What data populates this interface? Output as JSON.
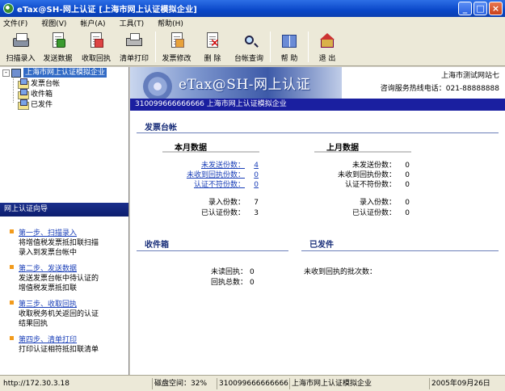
{
  "window": {
    "title": "eTax@SH-网上认证 [上海市网上认证模拟企业]",
    "controls": {
      "minimize": "_",
      "maximize": "□",
      "close": "×"
    }
  },
  "menu": [
    "文件(F)",
    "视图(V)",
    "帐户(A)",
    "工具(T)",
    "帮助(H)"
  ],
  "toolbar": [
    {
      "label": "扫描录入",
      "icon": "scanner-icon"
    },
    {
      "label": "发送数据",
      "icon": "send-data-icon"
    },
    {
      "label": "收取回执",
      "icon": "receive-receipt-icon"
    },
    {
      "label": "清单打印",
      "icon": "print-icon"
    },
    {
      "label": "发票修改",
      "icon": "edit-invoice-icon"
    },
    {
      "label": "删 除",
      "icon": "delete-icon"
    },
    {
      "label": "台帐查询",
      "icon": "query-icon"
    },
    {
      "label": "帮 助",
      "icon": "help-book-icon"
    },
    {
      "label": "退 出",
      "icon": "exit-house-icon"
    }
  ],
  "tree": {
    "toggle": "-",
    "root": "上海市网上认证模拟企业",
    "children": [
      "发票台帐",
      "收件箱",
      "已发件"
    ]
  },
  "guide": {
    "title": "网上认证向导",
    "steps": [
      {
        "title": "第一步、扫描录入",
        "desc1": "将增值税发票抵扣联扫描",
        "desc2": "录入到发票台帐中"
      },
      {
        "title": "第二步、发送数据",
        "desc1": "发送发票台帐中待认证的",
        "desc2": "增值税发票抵扣联"
      },
      {
        "title": "第三步、收取回执",
        "desc1": "收取税务机关返回的认证",
        "desc2": "结果回执"
      },
      {
        "title": "第四步、清单打印",
        "desc1": "打印认证相符抵扣联清单",
        "desc2": ""
      }
    ]
  },
  "banner": {
    "logo": "eTax@SH-网上认证",
    "station": "上海市测试网站七",
    "hotline": "咨询服务热线电话：021-88888888"
  },
  "idbar": "310099666666666  上海市网上认证模拟企业",
  "ledger": {
    "title": "发票台帐",
    "this_month": {
      "title": "本月数据",
      "unsent_label": "未发送份数：",
      "unsent_value": "4",
      "no_receipt_label": "未收到回执份数：",
      "no_receipt_value": "0",
      "mismatch_label": "认证不符份数：",
      "mismatch_value": "0",
      "entered_label": "录入份数：",
      "entered_value": "7",
      "certified_label": "已认证份数：",
      "certified_value": "3"
    },
    "last_month": {
      "title": "上月数据",
      "unsent_label": "未发送份数：",
      "unsent_value": "0",
      "no_receipt_label": "未收到回执份数：",
      "no_receipt_value": "0",
      "mismatch_label": "认证不符份数：",
      "mismatch_value": "0",
      "entered_label": "录入份数：",
      "entered_value": "0",
      "certified_label": "已认证份数：",
      "certified_value": "0"
    }
  },
  "inbox": {
    "title": "收件箱",
    "unread_label": "未读回执：",
    "unread_value": "0",
    "total_label": "回执总数：",
    "total_value": "0"
  },
  "sent": {
    "title": "已发件",
    "pending_label": "未收到回执的批次数："
  },
  "status": {
    "url": "http://172.30.3.18",
    "disk_label": "磁盘空间：",
    "disk_value": "32%",
    "tax_id": "310099666666666",
    "company": "上海市网上认证模拟企业",
    "date": "2005年09月26日"
  }
}
